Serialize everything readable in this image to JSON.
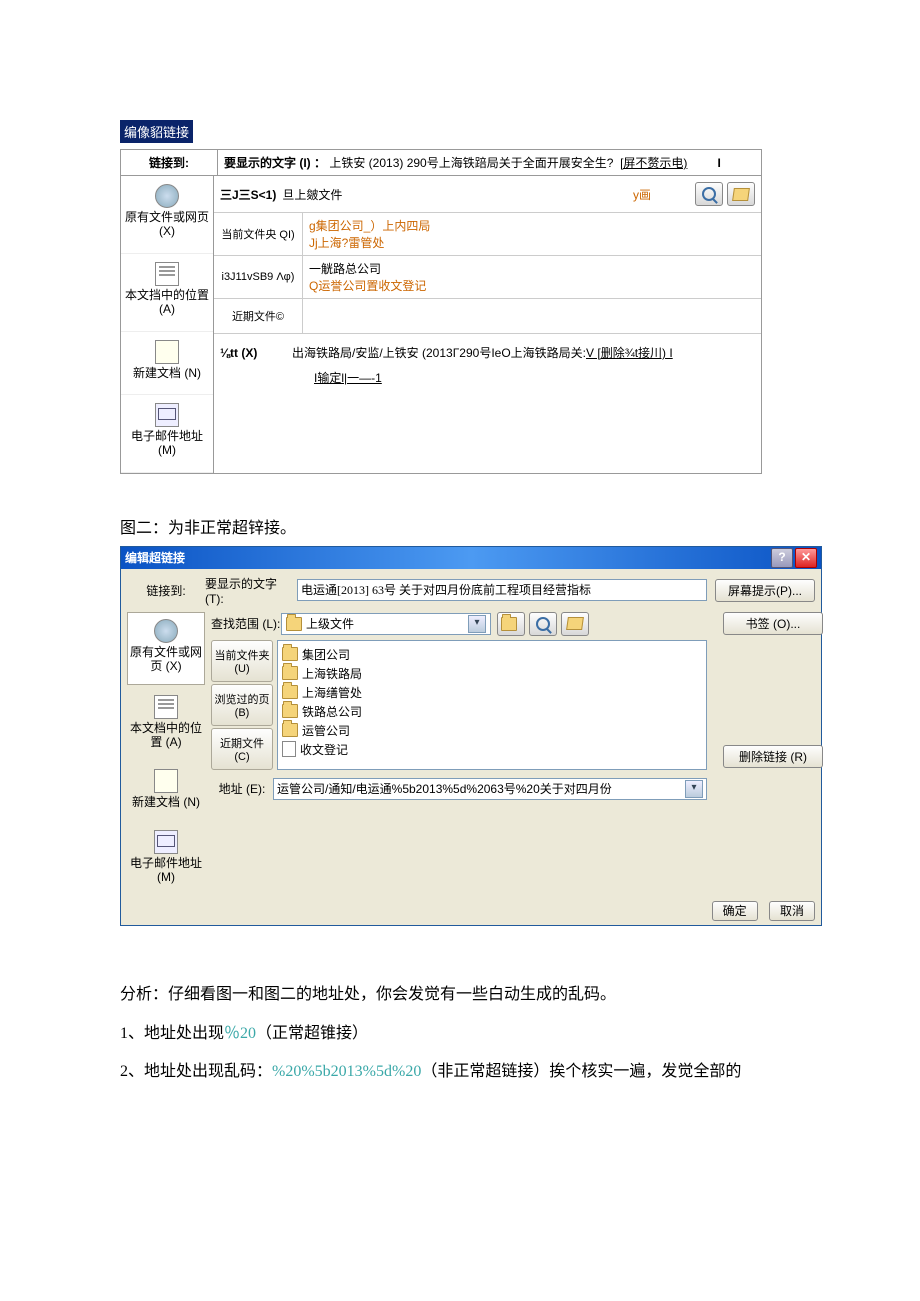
{
  "dlg1": {
    "header": "编像貂链接",
    "link_to_label": "链接到:",
    "display_text_label": "要显示的文字 (I) ：",
    "display_text_value": "上铁安 (2013) 290号上海铁踣局关于全面开展安全生?",
    "screen_tip": "[屏不赘示电)",
    "sidebar": {
      "existing": "原有文件或网页 (X)",
      "place": "本文挡中的位置 (A)",
      "newdoc": "新建文档 (N)",
      "email": "电子邮件地址 (M)"
    },
    "search_label": "三J三S<1)",
    "search_value": "旦上皴文件",
    "y_label": "y画",
    "tabs": {
      "current": "当前文件央 QI)",
      "browsed": "i3J11vSB9 Λφ)",
      "recent": "近期文件©"
    },
    "list": {
      "r1a": "g集团公司_）上内四局",
      "r1b": "Jj上海?雷管处",
      "r2a": "一觥路总公司",
      "r2b": "Q运誉公司置收文登记"
    },
    "addr_label": "⅛tt (X)",
    "addr_value": "出海铁路局/安监/上铁安 (2013Γ290号IeO上海铁路局关:",
    "addr_suffix": "V [删除¾t接川) I",
    "ok": "I输定l|一—-1",
    "end_i": "I"
  },
  "caption2": "图二：为非正常超锌接。",
  "dlg2": {
    "title": "编辑超链接",
    "link_to_label": "链接到:",
    "display_text_label": "要显示的文字 (T):",
    "display_text_value": "电运通[2013] 63号 关于对四月份底前工程项目经营指标",
    "screen_tip_btn": "屏幕提示(P)...",
    "sidebar": {
      "existing": "原有文件或网页 (X)",
      "place": "本文档中的位置 (A)",
      "newdoc": "新建文档 (N)",
      "email": "电子邮件地址 (M)"
    },
    "search_label": "查找范围 (L):",
    "search_value": "上级文件",
    "tabs": {
      "current": "当前文件夹 (U)",
      "browsed": "浏览过的页 (B)",
      "recent": "近期文件 (C)"
    },
    "list": {
      "i0": "集团公司",
      "i1": "上海铁路局",
      "i2": "上海缮管处",
      "i3": "铁路总公司",
      "i4": "运管公司",
      "i5": "收文登记"
    },
    "bookmark_btn": "书签 (O)...",
    "addr_label": "地址 (E):",
    "addr_value": "运管公司/通知/电运通%5b2013%5d%2063号%20关于对四月份",
    "remove_btn": "删除链接 (R)",
    "ok_btn": "确定",
    "cancel_btn": "取消"
  },
  "para": {
    "analysis": "分析：仔细看图一和图二的地址处，你会发觉有一些白动生成的乱码。",
    "l1a": "1、地址处出现",
    "l1code": "％20",
    "l1b": "（正常超锥接）",
    "l2a": "2、地址处出现乱码：",
    "l2code": "%20%5b2013%5d%20",
    "l2b": "（非正常超链接）挨个核实一遍，发觉全部的"
  }
}
